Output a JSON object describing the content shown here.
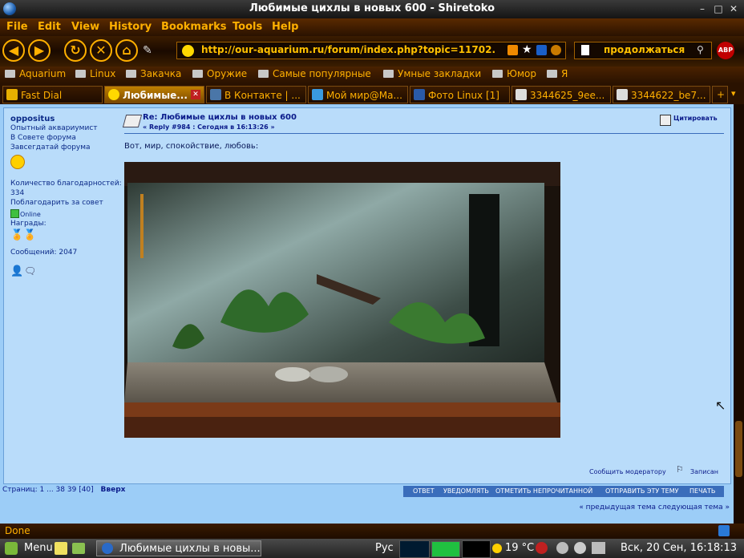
{
  "window": {
    "title": "Любимые цихлы в новых 600 - Shiretoko"
  },
  "menu": [
    "File",
    "Edit",
    "View",
    "History",
    "Bookmarks",
    "Tools",
    "Help"
  ],
  "nav": {
    "url": "http://our-aquarium.ru/forum/index.php?topic=11702.",
    "search": "продолжаться"
  },
  "bookmarks": [
    "Aquarium",
    "Linux",
    "Закачка",
    "Оружие",
    "Самые популярные",
    "Умные закладки",
    "Юмор",
    "Я"
  ],
  "tabs": [
    "Fast Dial",
    "Любимые...",
    "В Контакте | ...",
    "Мой мир@Ма...",
    "Фото Linux [1]",
    "3344625_9ee...",
    "3344622_be7..."
  ],
  "tab_plus": "+",
  "user": {
    "name": "oppositus",
    "rank": "Опытный аквариумист",
    "council": "В Совете форума",
    "status": "Завсегдатай форума",
    "thanks_label": "Количество благодарностей:",
    "thanks": "334",
    "thank_link": "Поблагодарить за совет",
    "online": "Online",
    "awards": "Награды:",
    "posts": "Сообщений: 2047"
  },
  "post": {
    "title": "Re: Любимые цихлы в новых 600",
    "meta": "« Reply #984 : Сегодня в 16:13:26 »",
    "quote": "Цитировать",
    "text": "Вот, мир, спокойствие, любовь:",
    "report": "Сообщить модератору",
    "logged": "Записан"
  },
  "pages": {
    "label": "Страниц:",
    "list": "1 ... 38 39 [40]",
    "up": "Вверх"
  },
  "actions": [
    "ОТВЕТ",
    "УВЕДОМЛЯТЬ",
    "ОТМЕТИТЬ НЕПРОЧИТАННОЙ",
    "ОТПРАВИТЬ ЭТУ ТЕМУ",
    "ПЕЧАТЬ"
  ],
  "topicnav": "« предыдущая тема следующая тема »",
  "status": "Done",
  "taskbar": {
    "menu": "Menu",
    "window": "Любимые цихлы в новы...",
    "lang": "Рус",
    "temp": "19 °C",
    "clock": "Вск, 20 Сен, 16:18:13"
  },
  "colors": {
    "accent": "#ffb000",
    "page_bg": "#9ccdf7",
    "link": "#0a1a8a"
  }
}
